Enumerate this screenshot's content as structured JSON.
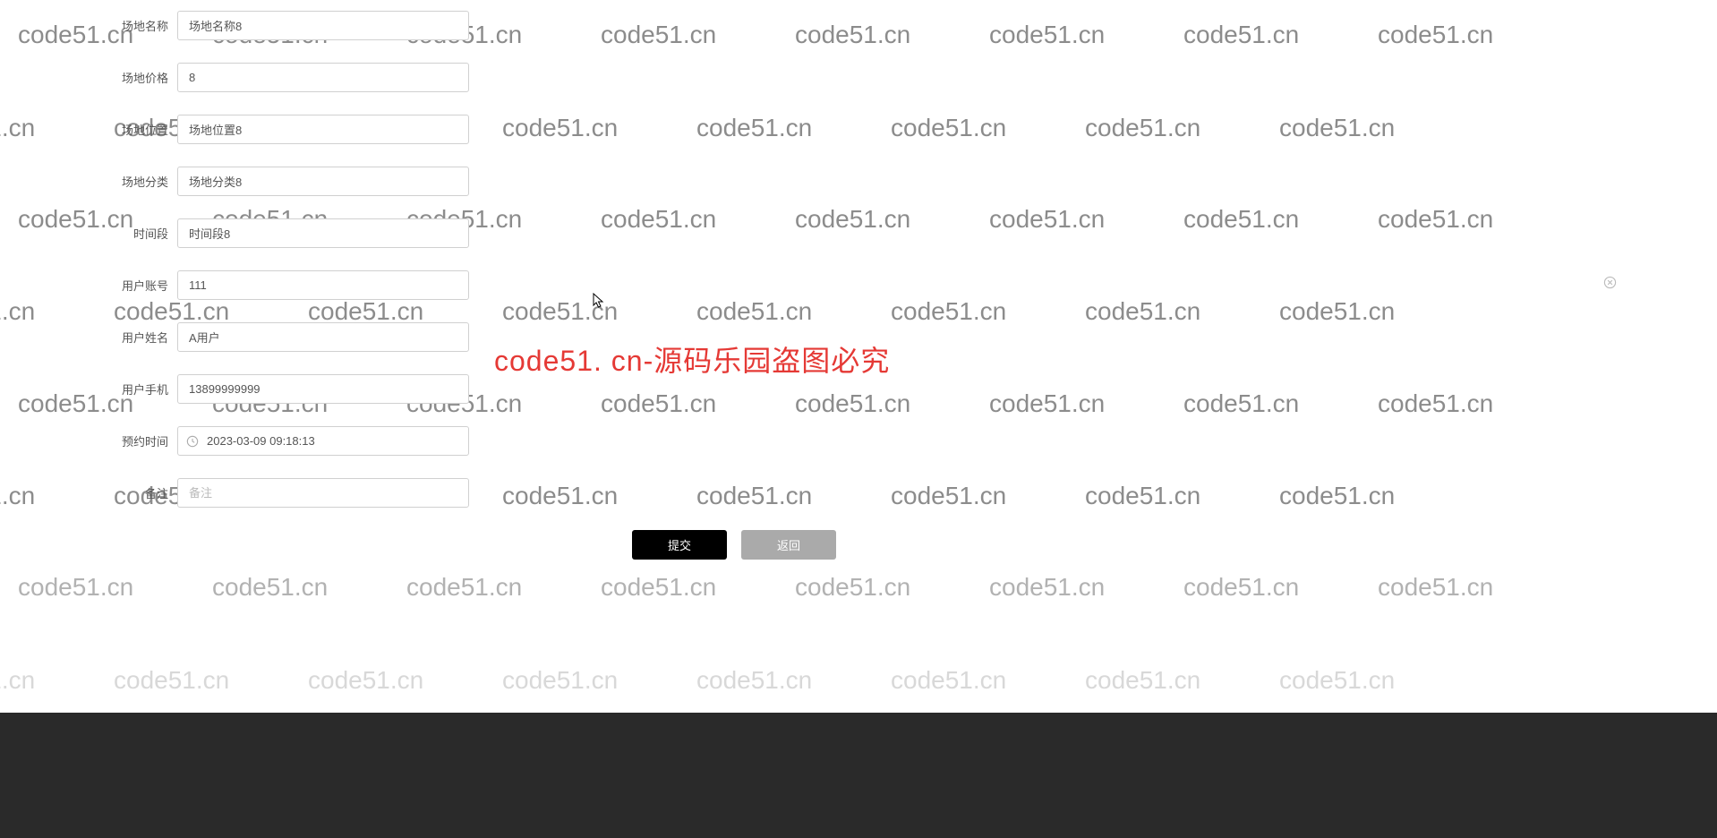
{
  "watermark": "code51.cn",
  "center_watermark": "code51. cn-源码乐园盗图必究",
  "form": {
    "venue_name": {
      "label": "场地名称",
      "value": "场地名称8"
    },
    "venue_price": {
      "label": "场地价格",
      "value": "8"
    },
    "venue_location": {
      "label": "场地位置",
      "value": "场地位置8"
    },
    "venue_category": {
      "label": "场地分类",
      "value": "场地分类8"
    },
    "time_slot": {
      "label": "时间段",
      "value": "时间段8"
    },
    "user_account": {
      "label": "用户账号",
      "value": "111"
    },
    "user_name": {
      "label": "用户姓名",
      "value": "A用户"
    },
    "user_phone": {
      "label": "用户手机",
      "value": "13899999999"
    },
    "reserve_time": {
      "label": "预约时间",
      "value": "2023-03-09 09:18:13"
    },
    "remark": {
      "label": "备注",
      "value": "",
      "placeholder": "备注"
    }
  },
  "buttons": {
    "submit": "提交",
    "back": "返回"
  }
}
